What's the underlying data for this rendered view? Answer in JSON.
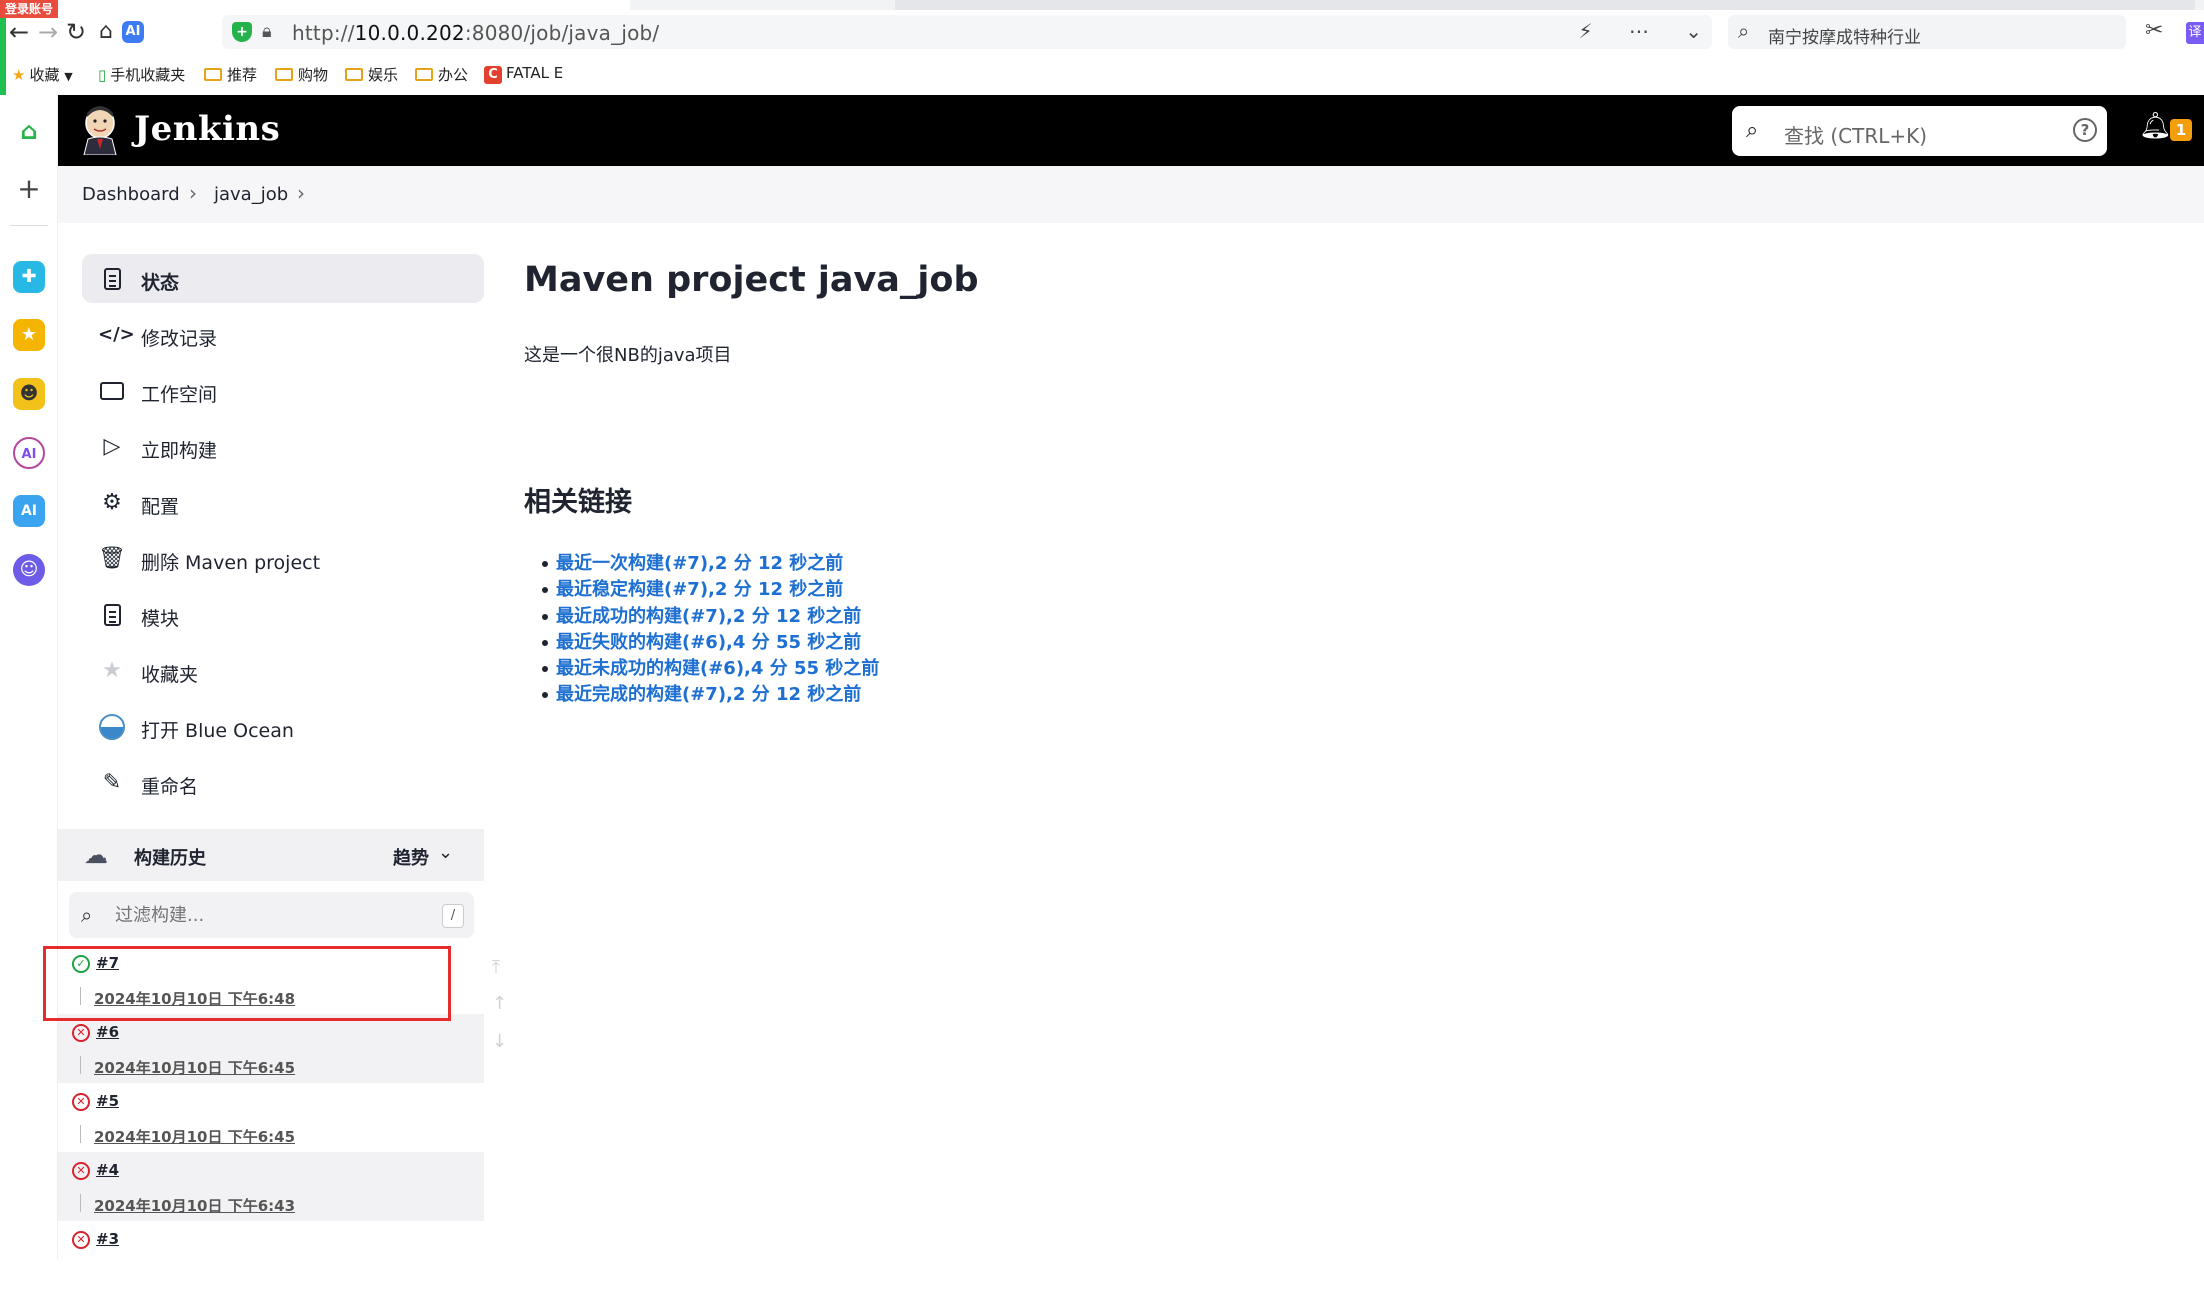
{
  "browser": {
    "login_badge": "登录账号",
    "url_prefix": "http://",
    "url_host": "10.0.0.202",
    "url_path": ":8080/job/java_job/",
    "search_placeholder": "南宁按摩成特种行业",
    "translate_label": "译",
    "bookmarks": [
      {
        "label": "收藏",
        "icon": "star-icon"
      },
      {
        "label": "手机收藏夹",
        "icon": "phone-icon"
      },
      {
        "label": "推荐",
        "icon": "folder-icon"
      },
      {
        "label": "购物",
        "icon": "folder-icon"
      },
      {
        "label": "娱乐",
        "icon": "folder-icon"
      },
      {
        "label": "办公",
        "icon": "folder-icon"
      },
      {
        "label": "FATAL E",
        "icon": "fatal-icon"
      }
    ]
  },
  "jenkins": {
    "title": "Jenkins",
    "search_placeholder": "查找 (CTRL+K)",
    "notification_count": "1"
  },
  "breadcrumb": [
    "Dashboard",
    "java_job"
  ],
  "tasks": [
    {
      "label": "状态",
      "icon": "document-icon",
      "active": true
    },
    {
      "label": "修改记录",
      "icon": "code-icon"
    },
    {
      "label": "工作空间",
      "icon": "folder-icon"
    },
    {
      "label": "立即构建",
      "icon": "play-icon"
    },
    {
      "label": "配置",
      "icon": "gear-icon"
    },
    {
      "label": "删除 Maven project",
      "icon": "trash-icon"
    },
    {
      "label": "模块",
      "icon": "file-icon"
    },
    {
      "label": "收藏夹",
      "icon": "star-icon"
    },
    {
      "label": "打开 Blue Ocean",
      "icon": "blue-ocean-icon"
    },
    {
      "label": "重命名",
      "icon": "pencil-icon"
    }
  ],
  "build_history": {
    "title": "构建历史",
    "trend_label": "趋势",
    "filter_placeholder": "过滤构建...",
    "filter_shortcut": "/",
    "builds": [
      {
        "number": "#7",
        "date": "2024年10月10日 下午6:48",
        "status": "success"
      },
      {
        "number": "#6",
        "date": "2024年10月10日 下午6:45",
        "status": "failed"
      },
      {
        "number": "#5",
        "date": "2024年10月10日 下午6:45",
        "status": "failed"
      },
      {
        "number": "#4",
        "date": "2024年10月10日 下午6:43",
        "status": "failed"
      },
      {
        "number": "#3",
        "date": "",
        "status": "failed"
      }
    ]
  },
  "main": {
    "title": "Maven project java_job",
    "description": "这是一个很NB的java项目",
    "links_title": "相关链接",
    "links": [
      "最近一次构建(#7),2 分 12 秒之前",
      "最近稳定构建(#7),2 分 12 秒之前",
      "最近成功的构建(#7),2 分 12 秒之前",
      "最近失败的构建(#6),4 分 55 秒之前",
      "最近未成功的构建(#6),4 分 55 秒之前",
      "最近完成的构建(#7),2 分 12 秒之前"
    ]
  },
  "colors": {
    "header_bg": "#000000",
    "link": "#1d6fd1",
    "success": "#1ea446",
    "failure": "#d8232f",
    "highlight": "#e52b2b",
    "notification": "#f59e0b"
  }
}
